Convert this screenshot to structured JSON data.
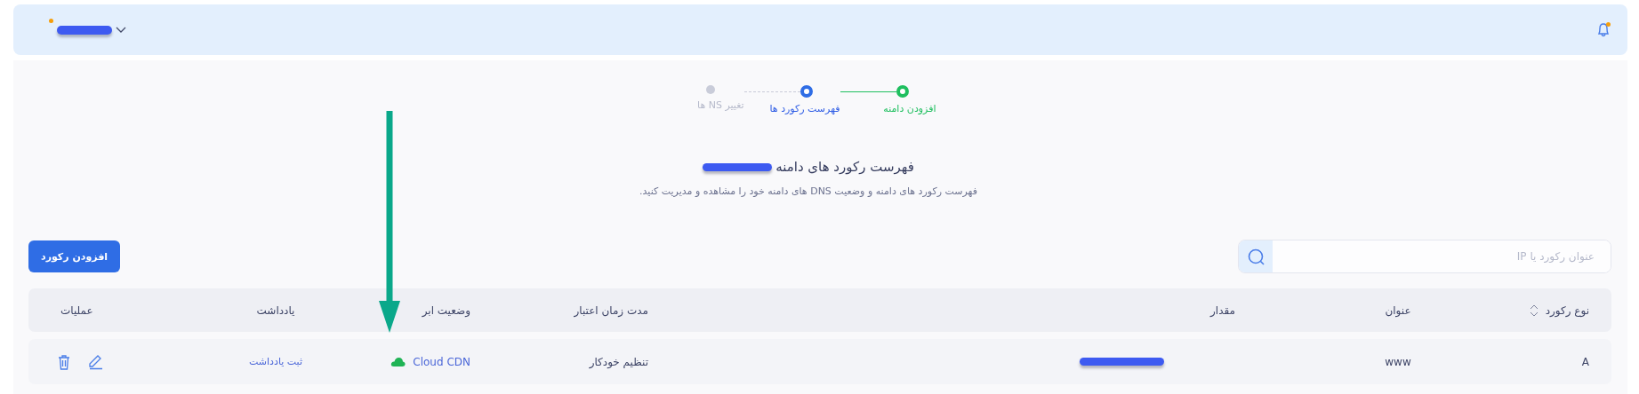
{
  "topbar": {
    "user": {
      "redacted": true,
      "status_dot": true
    },
    "notifications": {
      "unread": true
    }
  },
  "stepper": [
    {
      "label": "افزودن دامنه",
      "done": true,
      "current": false
    },
    {
      "label": "فهرست رکورد ها",
      "done": false,
      "current": true
    },
    {
      "label": "تغییر NS ها",
      "done": false,
      "current": false
    }
  ],
  "heading": {
    "title": "فهرست رکورد های دامنه",
    "domain_redacted": true,
    "subtitle": "فهرست رکورد های دامنه و وضعیت DNS های دامنه خود را مشاهده و مدیریت کنید."
  },
  "search": {
    "placeholder": "عنوان رکورد یا IP"
  },
  "add_button": "افزودن رکورد",
  "table": {
    "columns": [
      {
        "label": "نوع رکورد",
        "sortable": true
      },
      {
        "label": "عنوان",
        "sortable": false
      },
      {
        "label": "مقدار",
        "sortable": false
      },
      {
        "label": "مدت زمان اعتبار",
        "sortable": false
      },
      {
        "label": "وضعیت ابر",
        "sortable": false
      },
      {
        "label": "یادداشت",
        "sortable": false
      },
      {
        "label": "عملیات",
        "sortable": false
      }
    ],
    "rows": [
      {
        "type": "A",
        "name": "www",
        "value_redacted": true,
        "ttl": "تنظیم خودکار",
        "cloud": {
          "label": "Cloud CDN",
          "on": true
        },
        "note": "ثبت یادداشت"
      }
    ]
  },
  "annotation": {
    "kind": "arrow"
  }
}
